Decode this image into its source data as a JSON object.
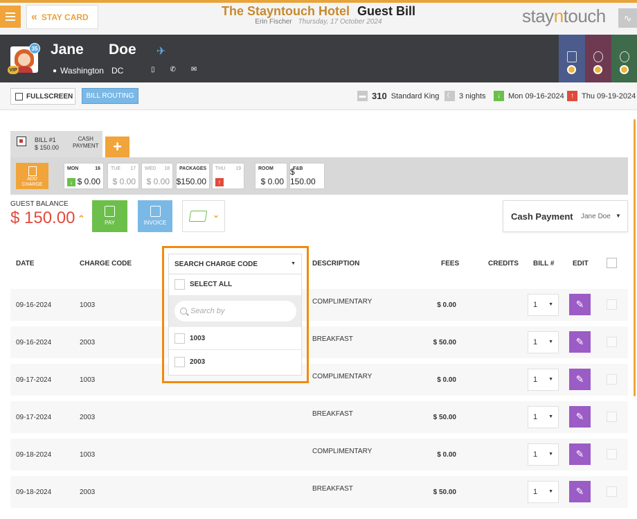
{
  "top": {
    "stay_card_label": "STAY CARD",
    "hotel_name": "The Stayntouch Hotel",
    "page_name": "Guest Bill",
    "user": "Erin Fischer",
    "date": "Thursday, 17 October 2024",
    "logo_pre": "stay",
    "logo_n": "n",
    "logo_post": "touch"
  },
  "guest": {
    "first_name": "Jane",
    "last_name": "Doe",
    "city": "Washington",
    "state": "DC",
    "loyalty_badge": "35",
    "vip_label": "VIP"
  },
  "toolbar": {
    "fullscreen_label": "FULLSCREEN",
    "bill_routing_label": "BILL ROUTING",
    "room_number": "310",
    "room_type": "Standard King",
    "nights": "3 nights",
    "arrival": "Mon 09-16-2024",
    "departure": "Thu 09-19-2024"
  },
  "bill_tab": {
    "bill_label": "BILL #1",
    "bill_amount": "$ 150.00",
    "payment_line1": "CASH",
    "payment_line2": "PAYMENT",
    "add_label": "+"
  },
  "days": {
    "add_charge_line1": "ADD",
    "add_charge_line2": "CHARGE",
    "items": [
      {
        "label": "MON",
        "num": "16",
        "amount": "$ 0.00"
      },
      {
        "label": "TUE",
        "num": "17",
        "amount": "$ 0.00"
      },
      {
        "label": "WED",
        "num": "18",
        "amount": "$ 0.00"
      },
      {
        "label": "PACKAGES",
        "num": "",
        "amount": "$150.00"
      },
      {
        "label": "THU",
        "num": "19",
        "amount": ""
      },
      {
        "label": "ROOM",
        "num": "",
        "amount": "$ 0.00"
      },
      {
        "label": "F&B",
        "num": "",
        "amount": "$ 150.00"
      }
    ]
  },
  "balance": {
    "label": "GUEST BALANCE",
    "amount": "$ 150.00",
    "pay_label": "PAY",
    "invoice_label": "INVOICE",
    "payment_method": "Cash Payment",
    "payment_name": "Jane Doe"
  },
  "table": {
    "headers": {
      "date": "DATE",
      "charge_code": "CHARGE CODE",
      "description": "DESCRIPTION",
      "fees": "FEES",
      "credits": "CREDITS",
      "bill": "BILL #",
      "edit": "EDIT"
    },
    "rows": [
      {
        "date": "09-16-2024",
        "code": "1003",
        "description": "COMPLIMENTARY",
        "fee": "$ 0.00",
        "bill": "1"
      },
      {
        "date": "09-16-2024",
        "code": "2003",
        "description": "BREAKFAST",
        "fee": "$ 50.00",
        "bill": "1"
      },
      {
        "date": "09-17-2024",
        "code": "1003",
        "description": "COMPLIMENTARY",
        "fee": "$ 0.00",
        "bill": "1"
      },
      {
        "date": "09-17-2024",
        "code": "2003",
        "description": "BREAKFAST",
        "fee": "$ 50.00",
        "bill": "1"
      },
      {
        "date": "09-18-2024",
        "code": "1003",
        "description": "COMPLIMENTARY",
        "fee": "$ 0.00",
        "bill": "1"
      },
      {
        "date": "09-18-2024",
        "code": "2003",
        "description": "BREAKFAST",
        "fee": "$ 50.00",
        "bill": "1"
      }
    ]
  },
  "charge_code_filter": {
    "header": "SEARCH CHARGE CODE",
    "select_all": "SELECT ALL",
    "search_placeholder": "Search by",
    "options": [
      "1003",
      "2003"
    ]
  },
  "colors": {
    "accent_orange": "#f0a43a",
    "highlight_orange": "#f28a0b",
    "balance_red": "#e04b3d",
    "edit_purple": "#9b5cc6",
    "pay_green": "#6cbf4a",
    "invoice_blue": "#7ab8e6"
  }
}
